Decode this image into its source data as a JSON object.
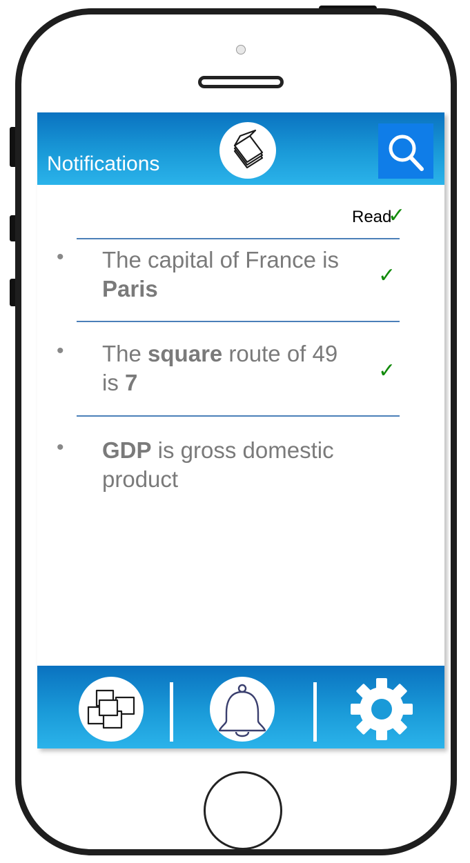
{
  "header": {
    "title": "Notifications",
    "notes_icon": "sticky-notes-icon",
    "search_icon": "search-icon",
    "colors": {
      "bar": "#1a9ad8",
      "search_button": "#0f7de8"
    }
  },
  "content": {
    "read_label": "Read",
    "read_check": "✓",
    "items": [
      {
        "parts": [
          "The capital of France is ",
          "Paris"
        ],
        "read": true,
        "check": "✓"
      },
      {
        "parts": [
          "The ",
          "square",
          " route of 49 is ",
          "7"
        ],
        "read": true,
        "check": "✓"
      },
      {
        "parts": [
          "GDP",
          " is gross domestic product"
        ],
        "read": false
      }
    ],
    "bullet": "•",
    "check_color": "#118a0a"
  },
  "footer": {
    "tabs": [
      {
        "icon": "notes-stack-icon"
      },
      {
        "icon": "bell-icon"
      },
      {
        "icon": "gear-icon"
      }
    ]
  }
}
